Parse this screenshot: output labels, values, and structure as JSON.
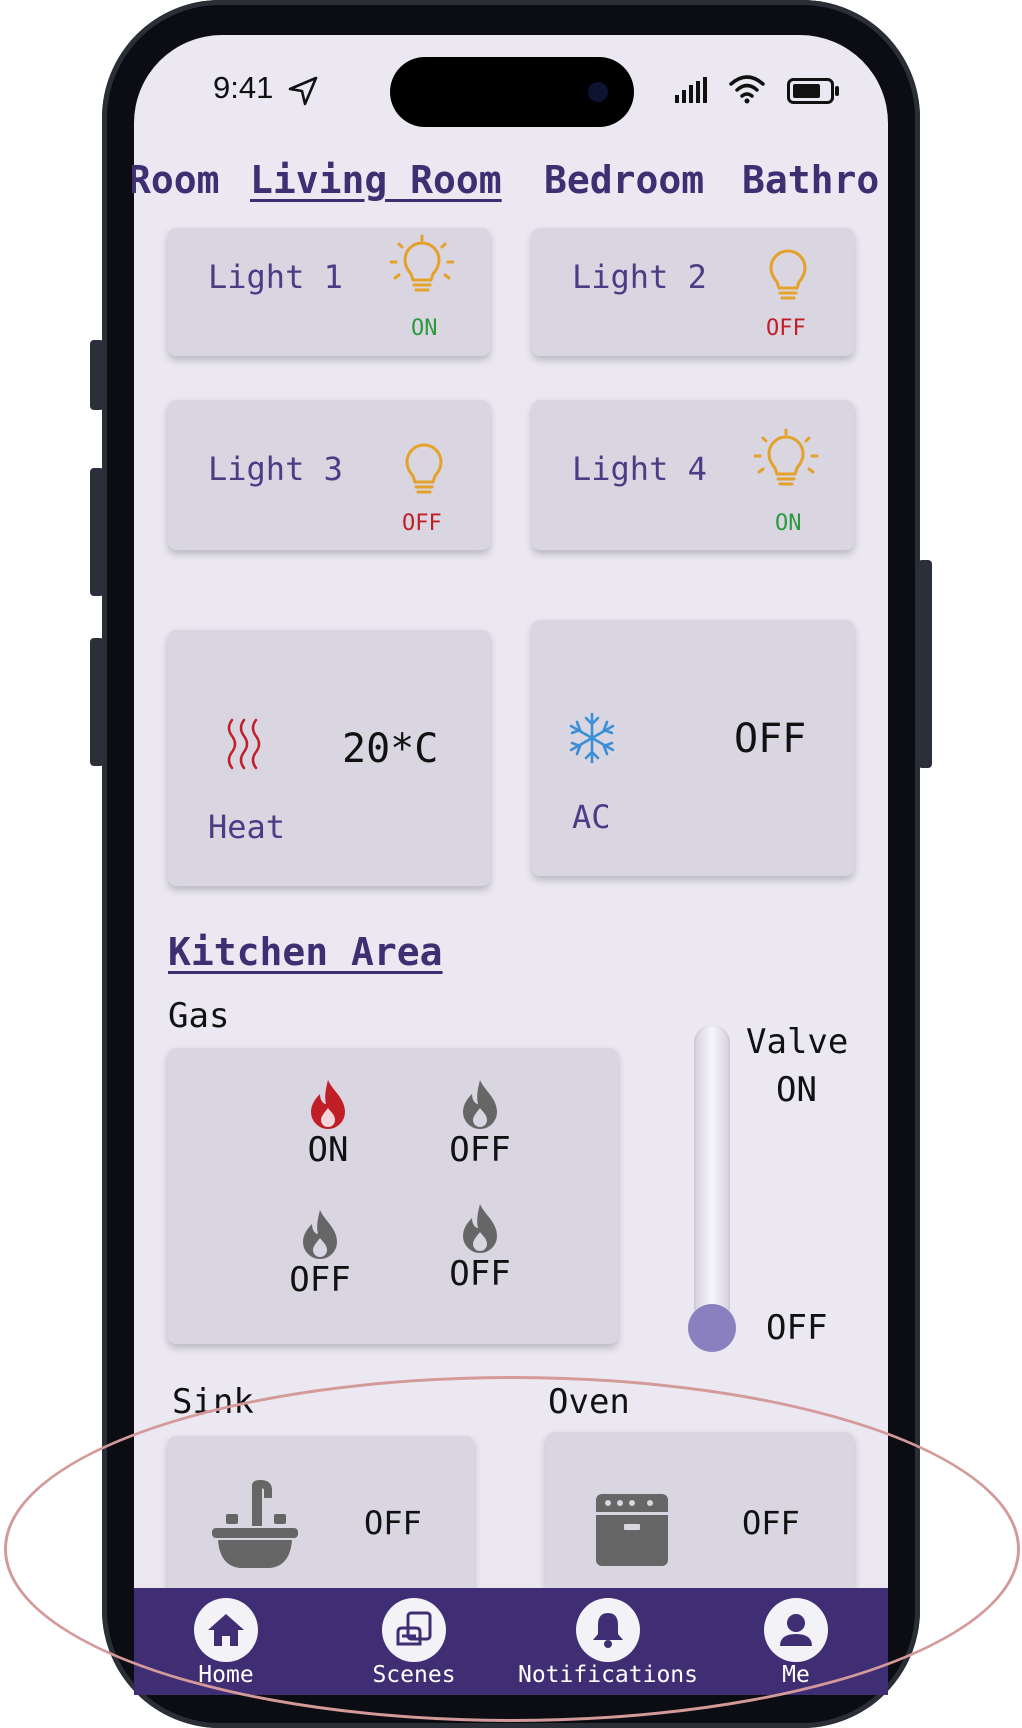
{
  "status_bar": {
    "time": "9:41"
  },
  "tabs": [
    {
      "label": "Room"
    },
    {
      "label": "Living Room"
    },
    {
      "label": "Bedroom"
    },
    {
      "label": "Bathro"
    }
  ],
  "lights": [
    {
      "label": "Light 1",
      "state": "ON"
    },
    {
      "label": "Light 2",
      "state": "OFF"
    },
    {
      "label": "Light 3",
      "state": "OFF"
    },
    {
      "label": "Light 4",
      "state": "ON"
    }
  ],
  "heat": {
    "label": "Heat",
    "value": "20*C"
  },
  "ac": {
    "label": "AC",
    "state": "OFF"
  },
  "kitchen": {
    "title": "Kitchen Area",
    "gas_label": "Gas",
    "burners": [
      {
        "state": "ON"
      },
      {
        "state": "OFF"
      },
      {
        "state": "OFF"
      },
      {
        "state": "OFF"
      }
    ],
    "valve": {
      "label": "Valve",
      "on_label": "ON",
      "off_label": "OFF"
    },
    "sink": {
      "label": "Sink",
      "state": "OFF"
    },
    "oven": {
      "label": "Oven",
      "state": "OFF"
    }
  },
  "nav": [
    {
      "label": "Home",
      "icon": "home-icon"
    },
    {
      "label": "Scenes",
      "icon": "scenes-icon"
    },
    {
      "label": "Notifications",
      "icon": "bell-icon"
    },
    {
      "label": "Me",
      "icon": "user-icon"
    }
  ],
  "colors": {
    "primary": "#3f2e73",
    "on": "#2a9a3c",
    "off": "#c01f28",
    "bulb": "#e4a22a",
    "card": "#d9d5e1",
    "background": "#ebe8f2"
  }
}
